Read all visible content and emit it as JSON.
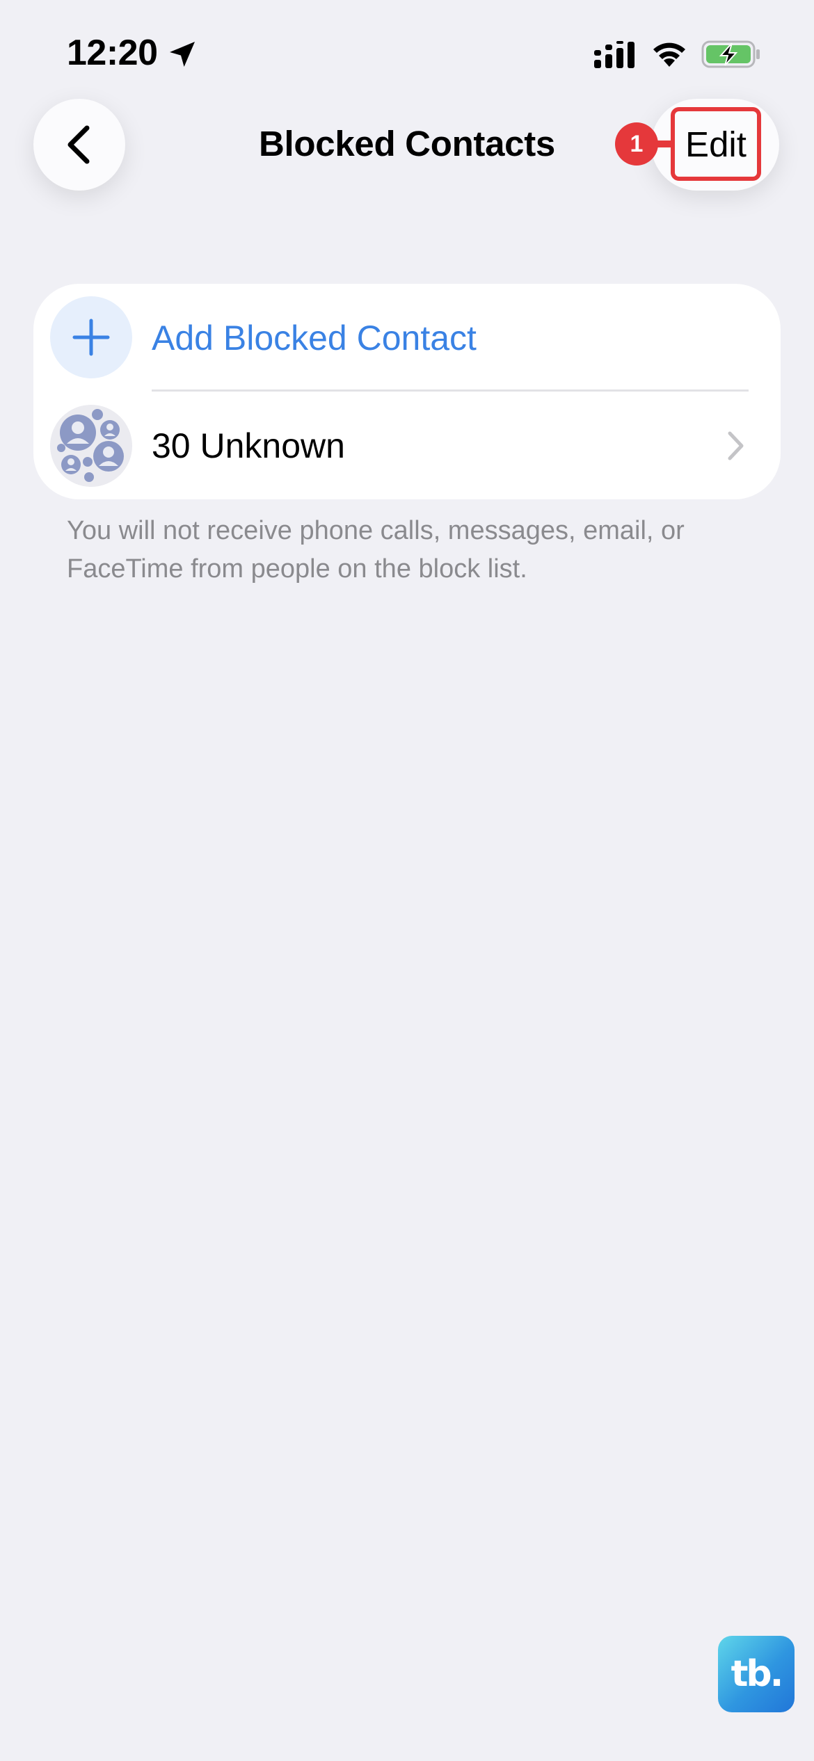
{
  "status_bar": {
    "time": "12:20",
    "icons": [
      "location-arrow-icon",
      "cellular-signal-icon",
      "wifi-icon",
      "battery-charging-icon"
    ]
  },
  "nav": {
    "back_icon": "chevron-left-icon",
    "title": "Blocked Contacts",
    "edit_label": "Edit",
    "step_badge": "1"
  },
  "list": {
    "add_label": "Add Blocked Contact",
    "add_icon": "plus-icon",
    "unknown_label": "30 Unknown",
    "unknown_icon": "group-avatar-icon"
  },
  "footer_note": "You will not receive phone calls, messages, email, or FaceTime from people on the block list.",
  "watermark": {
    "text": "tb."
  },
  "colors": {
    "background": "#f0f0f5",
    "accent_blue": "#3a82e4",
    "annotation_red": "#e5383b",
    "secondary_text": "#8a8a8e",
    "battery_green": "#65c466"
  }
}
